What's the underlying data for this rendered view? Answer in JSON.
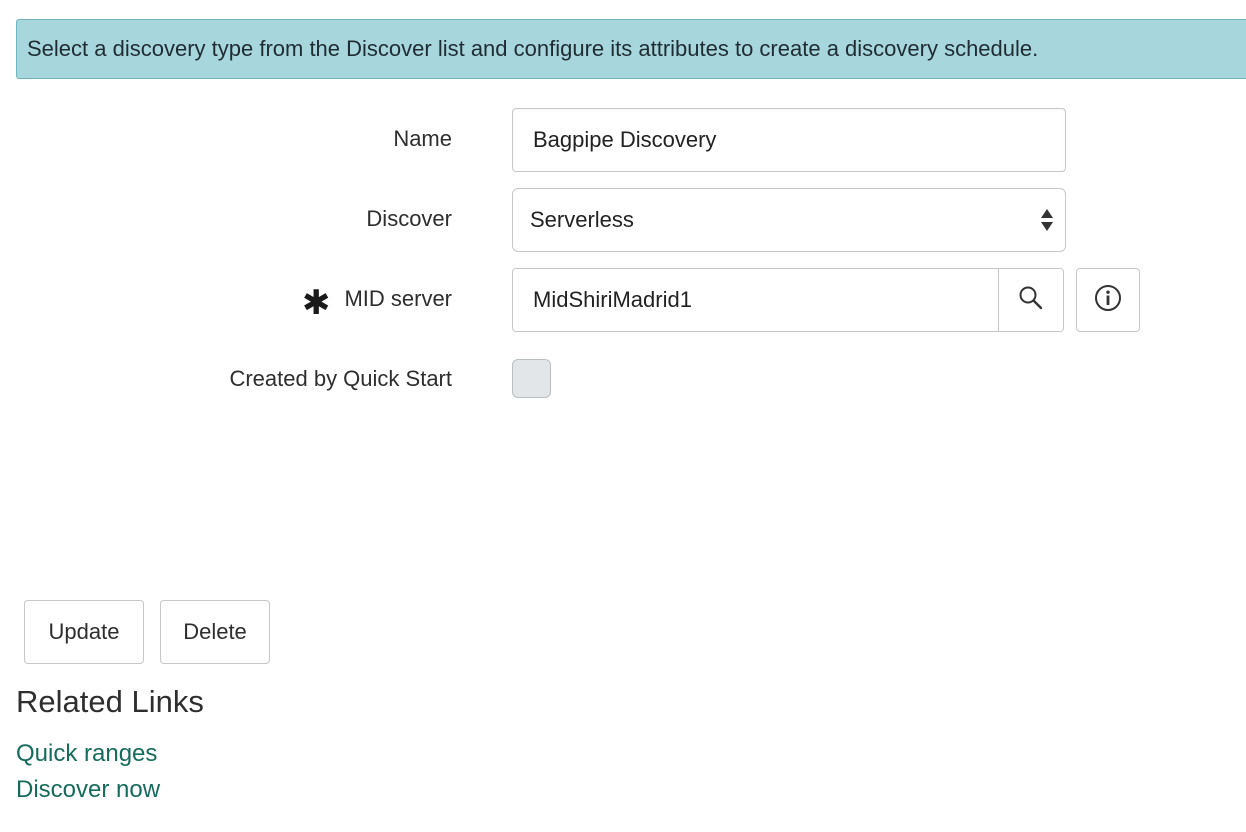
{
  "banner": {
    "message": "Select a discovery type from the Discover list and configure its attributes to create a discovery schedule.",
    "background_color": "#a7d6dc"
  },
  "form": {
    "name": {
      "label": "Name",
      "value": "Bagpipe Discovery"
    },
    "discover": {
      "label": "Discover",
      "selected": "Serverless",
      "icon": "updown-arrows-icon"
    },
    "mid_server": {
      "label": "MID server",
      "required": true,
      "required_marker": "✱",
      "value": "MidShiriMadrid1",
      "lookup_icon": "search-icon",
      "info_icon": "info-icon"
    },
    "created_by_quick_start": {
      "label": "Created by Quick Start",
      "checked": false
    }
  },
  "actions": {
    "update_label": "Update",
    "delete_label": "Delete"
  },
  "related_links": {
    "title": "Related Links",
    "links": [
      {
        "label": "Quick ranges"
      },
      {
        "label": "Discover now"
      }
    ],
    "link_color": "#176b5c"
  }
}
